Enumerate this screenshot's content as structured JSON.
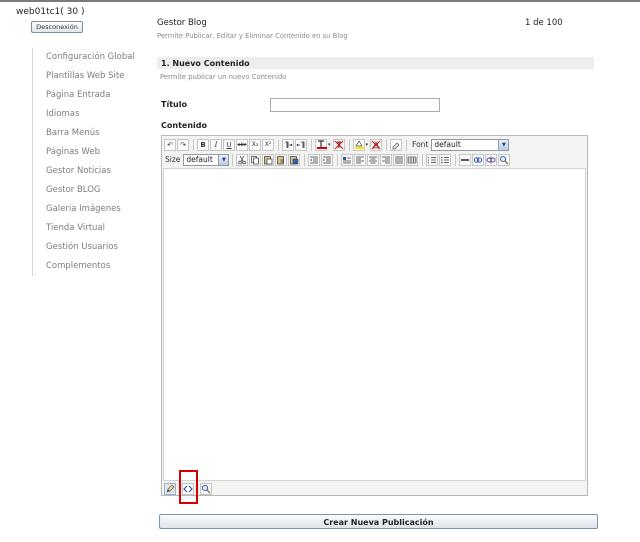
{
  "user": {
    "title": "web01tc1( 30 )",
    "logout_label": "Desconexión"
  },
  "sidebar": {
    "items": [
      {
        "label": "Configuración Global"
      },
      {
        "label": "Plantillas Web Site"
      },
      {
        "label": "Página Entrada"
      },
      {
        "label": "Idiomas"
      },
      {
        "label": "Barra Menús"
      },
      {
        "label": "Páginas Web"
      },
      {
        "label": "Gestor Noticias"
      },
      {
        "label": "Gestor BLOG"
      },
      {
        "label": "Galeria Imágenes"
      },
      {
        "label": "Tienda Virtual"
      },
      {
        "label": "Gestión Usuarios"
      },
      {
        "label": "Complementos"
      }
    ]
  },
  "header": {
    "title": "Gestor Blog",
    "subtitle": "Permite Publicar, Editar y Eliminar Contenido en su Blog",
    "pagination": "1 de 100"
  },
  "section": {
    "title": "1. Nuevo Contenido",
    "subtitle": "Permite publicar un nuevo Contenido"
  },
  "form": {
    "title_label": "Título",
    "title_value": "",
    "content_label": "Contenido",
    "submit_label": "Crear Nueva Publicación"
  },
  "editor": {
    "font_label": "Font",
    "font_value": "default",
    "size_label": "Size",
    "size_value": "default",
    "buttons": {
      "bold": "B",
      "italic": "I",
      "underline": "U",
      "strike": "abc",
      "subscript": "X₂",
      "superscript": "X²",
      "undo": "↶",
      "redo": "↷",
      "dropdown_arrow": "▼",
      "color_arrow": "▾"
    },
    "footer_modes": [
      "design-mode-icon",
      "html-mode-icon",
      "preview-mode-icon"
    ]
  },
  "colors": {
    "highlight": "#d60000",
    "text_color": "#d40000",
    "back_color": "#ffe600"
  }
}
